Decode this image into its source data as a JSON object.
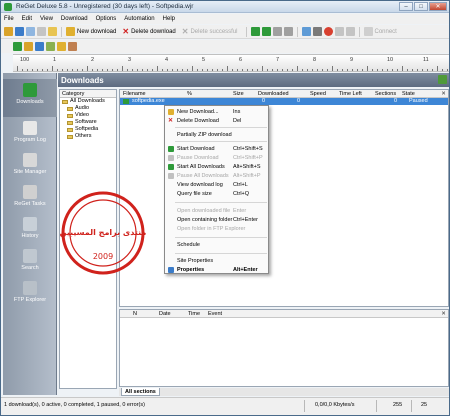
{
  "window": {
    "title": "ReGet Deluxe 5.8 - Unregistered (30 days left) - Softpedia.wjr",
    "controls": {
      "minimize": "–",
      "maximize": "□",
      "close": "✕"
    }
  },
  "menu": [
    "File",
    "Edit",
    "View",
    "Download",
    "Options",
    "Automation",
    "Help"
  ],
  "toolbar": {
    "new_download": "New download",
    "delete_download": "Delete download",
    "delete_successful": "Delete successful",
    "connect": "Connect"
  },
  "ruler": {
    "labels": [
      "100",
      "1",
      "2",
      "3",
      "4",
      "5",
      "6",
      "7",
      "8",
      "9",
      "10",
      "11"
    ]
  },
  "sidebar": {
    "items": [
      {
        "label": "Downloads"
      },
      {
        "label": "Program Log"
      },
      {
        "label": "Site Manager"
      },
      {
        "label": "ReGet Tasks"
      },
      {
        "label": "History"
      },
      {
        "label": "Search"
      },
      {
        "label": "FTP Explorer"
      }
    ]
  },
  "panel": {
    "title": "Downloads"
  },
  "category": {
    "header": "Category",
    "tree": [
      {
        "label": "All Downloads"
      },
      {
        "label": "Audio"
      },
      {
        "label": "Video"
      },
      {
        "label": "Software"
      },
      {
        "label": "Softpedia"
      },
      {
        "label": "Others"
      }
    ]
  },
  "list": {
    "columns": [
      "Filename",
      "%",
      "Size",
      "Downloaded",
      "Speed",
      "Time Left",
      "Sections",
      "State"
    ],
    "rows": [
      {
        "filename": "softpedia.exe",
        "percent": "",
        "size": "",
        "downloaded": "0",
        "speed": "0",
        "time_left": "",
        "sections": "0",
        "state": "Paused"
      }
    ]
  },
  "context_menu": {
    "items": [
      {
        "label": "New Download...",
        "key": "Ins",
        "disabled": false
      },
      {
        "label": "Delete Download",
        "key": "Del",
        "disabled": false
      },
      {
        "label": "Partially ZIP download",
        "key": "",
        "disabled": false
      },
      {
        "label": "Start Download",
        "key": "Ctrl+Shift+S",
        "disabled": false
      },
      {
        "label": "Pause Download",
        "key": "Ctrl+Shift+P",
        "disabled": true
      },
      {
        "label": "Start All Downloads",
        "key": "Alt+Shift+S",
        "disabled": false
      },
      {
        "label": "Pause All Downloads",
        "key": "Alt+Shift+P",
        "disabled": true
      },
      {
        "label": "View download log",
        "key": "Ctrl+L",
        "disabled": false
      },
      {
        "label": "Query file size",
        "key": "Ctrl+Q",
        "disabled": false
      },
      {
        "label": "Open downloaded file",
        "key": "Enter",
        "disabled": true
      },
      {
        "label": "Open containing folder",
        "key": "Ctrl+Enter",
        "disabled": false
      },
      {
        "label": "Open folder in FTP Explorer",
        "key": "",
        "disabled": true
      },
      {
        "label": "Schedule",
        "key": "",
        "disabled": false
      },
      {
        "label": "Site Properties",
        "key": "",
        "disabled": false
      },
      {
        "label": "Properties",
        "key": "Alt+Enter",
        "disabled": false
      }
    ]
  },
  "log": {
    "columns": [
      "N",
      "Date",
      "Time",
      "Event"
    ]
  },
  "tabs": {
    "all_sections": "All sections"
  },
  "statusbar": {
    "summary": "1 download(s), 0 active, 0 completed, 1 paused, 0 error(s)",
    "speed": "0,0/0,0 Kbytes/s",
    "value1": "255",
    "value2": "25"
  },
  "watermark": {
    "year": "2009",
    "text_ar": "منتدى برامج المسيبين"
  },
  "colors": {
    "header_bg": "#5d6b80",
    "selected_row": "#3d86d6",
    "sidebar_bg": "#9aa6b5",
    "stamp_red": "#d0221c"
  }
}
